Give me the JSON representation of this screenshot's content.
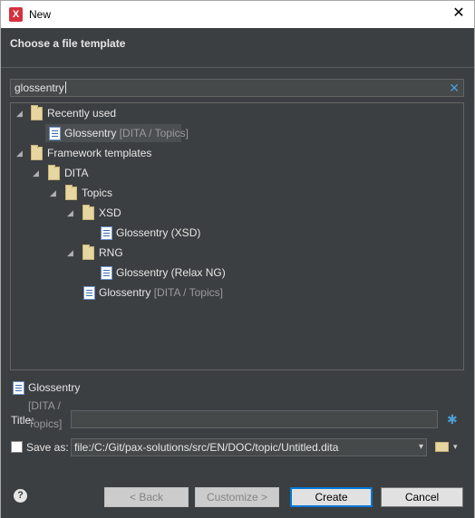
{
  "window": {
    "title": "New",
    "app_icon_glyph": "X"
  },
  "header": {
    "title": "Choose a file template"
  },
  "search": {
    "value": "glossentry"
  },
  "tree": {
    "recently_used": {
      "label": "Recently used"
    },
    "recent_item": {
      "name": "Glossentry",
      "path": "[DITA / Topics]"
    },
    "framework_templates": {
      "label": "Framework templates"
    },
    "dita": {
      "label": "DITA"
    },
    "topics": {
      "label": "Topics"
    },
    "xsd": {
      "label": "XSD"
    },
    "xsd_item": {
      "label": "Glossentry (XSD)"
    },
    "rng": {
      "label": "RNG"
    },
    "rng_item": {
      "label": "Glossentry (Relax NG)"
    },
    "topics_item": {
      "name": "Glossentry",
      "path": "[DITA / Topics]"
    }
  },
  "preview": {
    "name": "Glossentry",
    "path": "[DITA / Topics]"
  },
  "form": {
    "title_label": "Title:",
    "title_value": "",
    "save_as_label": "Save as:",
    "save_as_checked": false,
    "save_as_path": "file:/C:/Git/pax-solutions/src/EN/DOC/topic/Untitled.dita"
  },
  "icons": {
    "expanded": "◢",
    "close": "✕",
    "clear": "✕",
    "gear": "✱",
    "dropdown": "▾",
    "help": "?"
  },
  "buttons": {
    "back": "< Back",
    "customize": "Customize >",
    "create": "Create",
    "cancel": "Cancel"
  },
  "colors": {
    "background": "#3c3f41",
    "accent": "#4a9fd6",
    "primary_border": "#0078d7"
  }
}
